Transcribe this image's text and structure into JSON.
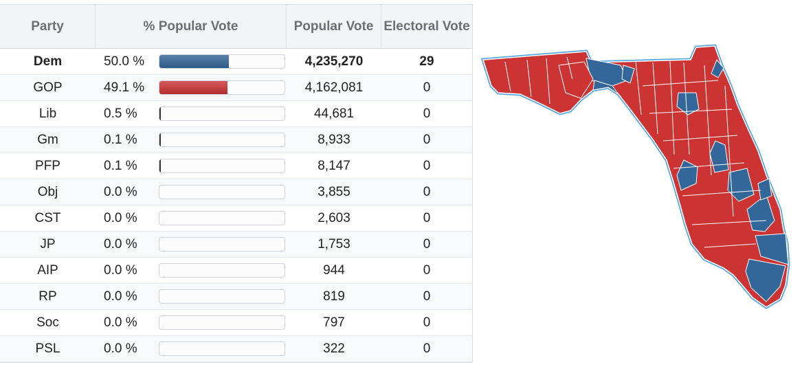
{
  "table": {
    "headers": {
      "party": "Party",
      "pct": "% Popular Vote",
      "votes": "Popular Vote",
      "ev": "Electoral Vote"
    }
  },
  "colors": {
    "dem": "#336699",
    "gop": "#cc3333",
    "other": "#333333",
    "map_outline": "#5aa7de"
  },
  "chart_data": {
    "type": "table",
    "columns": [
      "Party",
      "% Popular Vote",
      "Popular Vote",
      "Electoral Vote"
    ],
    "rows": [
      {
        "party": "Dem",
        "pct": 50.0,
        "pct_label": "50.0 %",
        "votes": "4,235,270",
        "ev": "29",
        "color": "#336699"
      },
      {
        "party": "GOP",
        "pct": 49.1,
        "pct_label": "49.1 %",
        "votes": "4,162,081",
        "ev": "0",
        "color": "#cc3333"
      },
      {
        "party": "Lib",
        "pct": 0.5,
        "pct_label": "0.5 %",
        "votes": "44,681",
        "ev": "0",
        "color": "#333333"
      },
      {
        "party": "Gm",
        "pct": 0.1,
        "pct_label": "0.1 %",
        "votes": "8,933",
        "ev": "0",
        "color": "#333333"
      },
      {
        "party": "PFP",
        "pct": 0.1,
        "pct_label": "0.1 %",
        "votes": "8,147",
        "ev": "0",
        "color": "#333333"
      },
      {
        "party": "Obj",
        "pct": 0.0,
        "pct_label": "0.0 %",
        "votes": "3,855",
        "ev": "0",
        "color": "#333333"
      },
      {
        "party": "CST",
        "pct": 0.0,
        "pct_label": "0.0 %",
        "votes": "2,603",
        "ev": "0",
        "color": "#333333"
      },
      {
        "party": "JP",
        "pct": 0.0,
        "pct_label": "0.0 %",
        "votes": "1,753",
        "ev": "0",
        "color": "#333333"
      },
      {
        "party": "AIP",
        "pct": 0.0,
        "pct_label": "0.0 %",
        "votes": "944",
        "ev": "0",
        "color": "#333333"
      },
      {
        "party": "RP",
        "pct": 0.0,
        "pct_label": "0.0 %",
        "votes": "819",
        "ev": "0",
        "color": "#333333"
      },
      {
        "party": "Soc",
        "pct": 0.0,
        "pct_label": "0.0 %",
        "votes": "797",
        "ev": "0",
        "color": "#333333"
      },
      {
        "party": "PSL",
        "pct": 0.0,
        "pct_label": "0.0 %",
        "votes": "322",
        "ev": "0",
        "color": "#333333"
      }
    ]
  }
}
